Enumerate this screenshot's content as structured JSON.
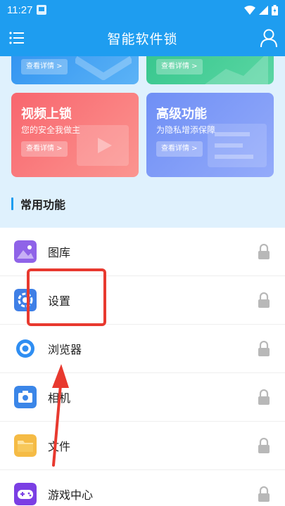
{
  "status_bar": {
    "time": "11:27"
  },
  "app_bar": {
    "title": "智能软件锁"
  },
  "cards": {
    "partial_left_btn": "查看详情 >",
    "partial_right_btn": "查看详情 >",
    "video": {
      "title": "视频上锁",
      "subtitle": "您的安全我做主",
      "button": "查看详情 >"
    },
    "advanced": {
      "title": "高级功能",
      "subtitle": "为隐私增添保障",
      "button": "查看详情 >"
    }
  },
  "section": {
    "title": "常用功能"
  },
  "apps": [
    {
      "label": "图库",
      "icon": "gallery-icon",
      "color": "#8f63e8"
    },
    {
      "label": "设置",
      "icon": "settings-icon",
      "color": "#3f7fe6"
    },
    {
      "label": "浏览器",
      "icon": "browser-icon",
      "color": "#2f8ef2"
    },
    {
      "label": "相机",
      "icon": "camera-icon",
      "color": "#3b86e8"
    },
    {
      "label": "文件",
      "icon": "folder-icon",
      "color": "#f5bb45"
    },
    {
      "label": "游戏中心",
      "icon": "gamepad-icon",
      "color": "#7b3fe4"
    }
  ],
  "colors": {
    "primary": "#1e9df0",
    "annotation": "#e8392f",
    "lock": "#b8b8b8"
  }
}
